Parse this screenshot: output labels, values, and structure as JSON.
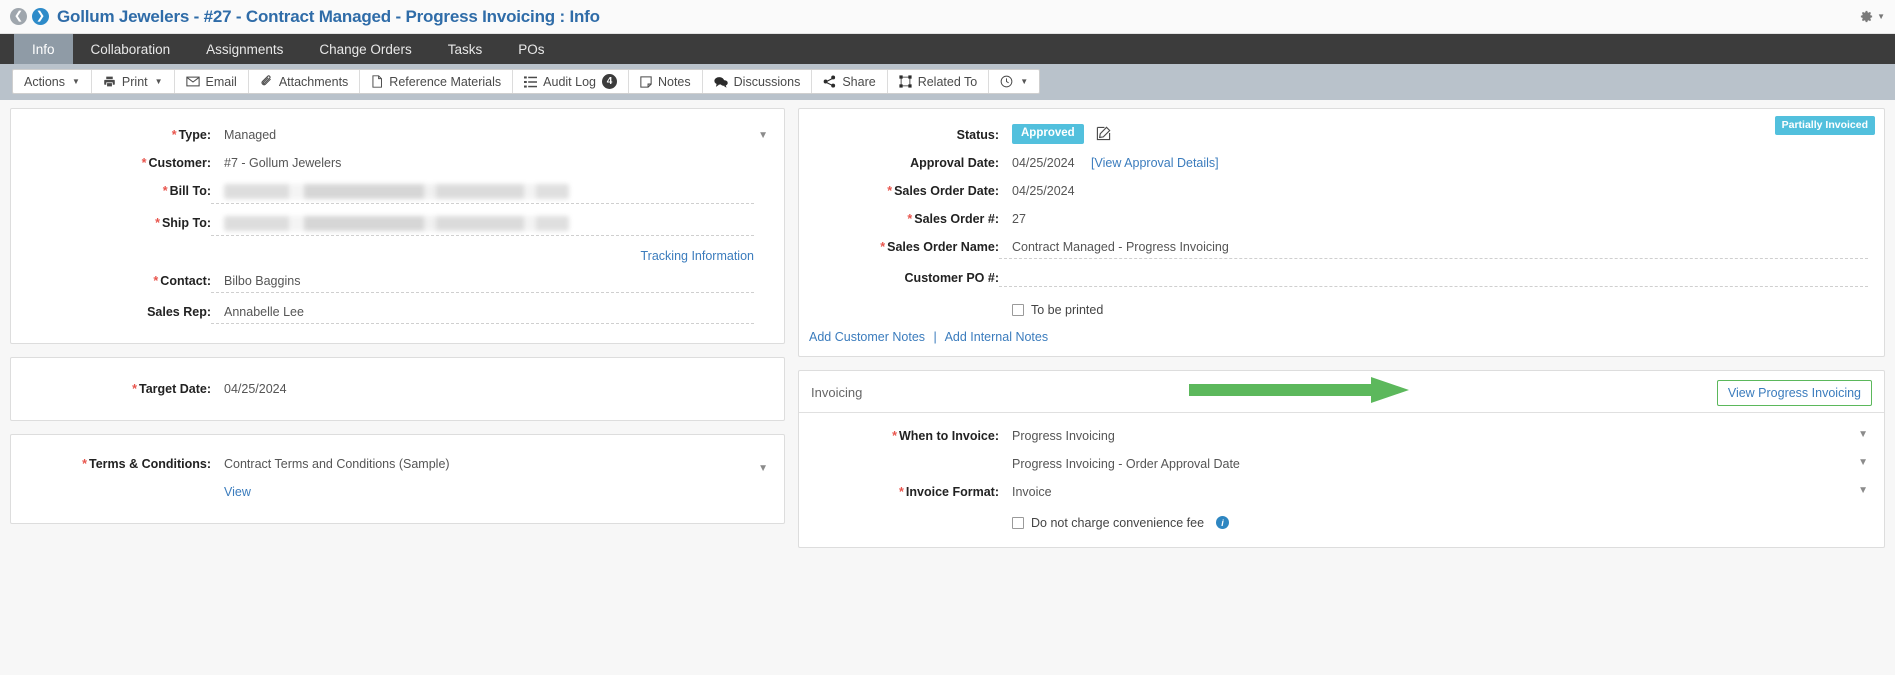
{
  "header": {
    "title": "Gollum Jewelers - #27 - Contract Managed - Progress Invoicing : Info",
    "back_icon": "arrow-left-circle-icon",
    "forward_icon": "arrow-right-circle-icon",
    "gear_icon": "gear-icon"
  },
  "tabs": [
    {
      "label": "Info",
      "active": true
    },
    {
      "label": "Collaboration",
      "active": false
    },
    {
      "label": "Assignments",
      "active": false
    },
    {
      "label": "Change Orders",
      "active": false
    },
    {
      "label": "Tasks",
      "active": false
    },
    {
      "label": "POs",
      "active": false
    }
  ],
  "toolbar": [
    {
      "label": "Actions",
      "icon": "none",
      "caret": true
    },
    {
      "label": "Print",
      "icon": "printer-icon",
      "caret": true
    },
    {
      "label": "Email",
      "icon": "envelope-icon",
      "caret": false
    },
    {
      "label": "Attachments",
      "icon": "paperclip-icon",
      "caret": false
    },
    {
      "label": "Reference Materials",
      "icon": "document-icon",
      "caret": false
    },
    {
      "label": "Audit Log",
      "icon": "list-icon",
      "caret": false,
      "badge": "4"
    },
    {
      "label": "Notes",
      "icon": "note-icon",
      "caret": false
    },
    {
      "label": "Discussions",
      "icon": "chat-icon",
      "caret": false
    },
    {
      "label": "Share",
      "icon": "share-icon",
      "caret": false
    },
    {
      "label": "Related To",
      "icon": "link-nodes-icon",
      "caret": false
    },
    {
      "label": "",
      "icon": "clock-icon",
      "caret": true
    }
  ],
  "left": {
    "info_card": {
      "type": {
        "label": "Type:",
        "required": true,
        "value": "Managed"
      },
      "customer": {
        "label": "Customer:",
        "required": true,
        "value": "#7 - Gollum Jewelers"
      },
      "bill_to": {
        "label": "Bill To:",
        "required": true,
        "value": ""
      },
      "ship_to": {
        "label": "Ship To:",
        "required": true,
        "value": ""
      },
      "tracking_link": "Tracking Information",
      "contact": {
        "label": "Contact:",
        "required": true,
        "value": "Bilbo Baggins"
      },
      "sales_rep": {
        "label": "Sales Rep:",
        "required": false,
        "value": "Annabelle Lee"
      }
    },
    "target_card": {
      "target_date": {
        "label": "Target Date:",
        "required": true,
        "value": "04/25/2024"
      }
    },
    "terms_card": {
      "terms": {
        "label": "Terms & Conditions:",
        "required": true,
        "value": "Contract Terms and Conditions (Sample)"
      },
      "view_link": "View"
    }
  },
  "right": {
    "status_card": {
      "status": {
        "label": "Status:",
        "required": false,
        "value": "Approved"
      },
      "invoiced_badge": "Partially Invoiced",
      "approval_date": {
        "label": "Approval Date:",
        "required": false,
        "value": "04/25/2024",
        "link": "[View Approval Details]"
      },
      "sales_order_date": {
        "label": "Sales Order Date:",
        "required": true,
        "value": "04/25/2024"
      },
      "sales_order_num": {
        "label": "Sales Order #:",
        "required": true,
        "value": "27"
      },
      "sales_order_name": {
        "label": "Sales Order Name:",
        "required": true,
        "value": "Contract Managed - Progress Invoicing"
      },
      "customer_po": {
        "label": "Customer PO #:",
        "required": false,
        "value": ""
      },
      "to_be_printed": {
        "label": "To be printed",
        "checked": false
      },
      "add_customer_notes": "Add Customer Notes",
      "add_internal_notes": "Add Internal Notes"
    },
    "invoicing_card": {
      "panel_title": "Invoicing",
      "view_progress_button": "View Progress Invoicing",
      "when_to_invoice": {
        "label": "When to Invoice:",
        "required": true,
        "value": "Progress Invoicing"
      },
      "when_to_invoice_detail": {
        "value": "Progress Invoicing - Order Approval Date"
      },
      "invoice_format": {
        "label": "Invoice Format:",
        "required": true,
        "value": "Invoice"
      },
      "convenience_fee": {
        "label": "Do not charge convenience fee",
        "checked": false
      }
    }
  },
  "colors": {
    "title_blue": "#2f6ca8",
    "tab_bar": "#3c3c3c",
    "toolbar_bg": "#b9c2cb",
    "badge_cyan": "#52c0dd",
    "annotation_green": "#5cb85c",
    "required_red": "#e8554d",
    "link_blue": "#3b7cbd"
  }
}
